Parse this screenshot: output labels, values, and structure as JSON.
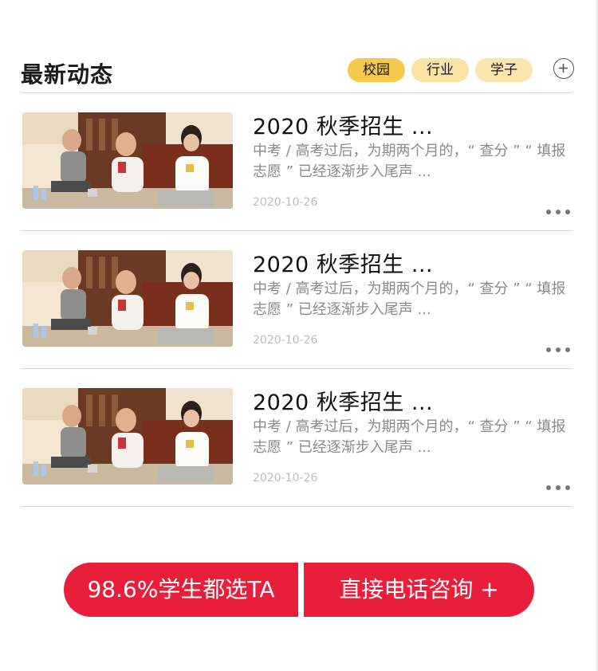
{
  "section": {
    "title": "最新动态",
    "tags": [
      {
        "label": "校园"
      },
      {
        "label": "行业"
      },
      {
        "label": "学子"
      }
    ]
  },
  "news": [
    {
      "title": "2020 秋季招生 ...",
      "desc": "中考 / 高考过后，为期两个月的，“ 查分 ” “ 填报志愿 ” 已经逐渐步入尾声 ...",
      "date": "2020-10-26"
    },
    {
      "title": "2020 秋季招生 ...",
      "desc": "中考 / 高考过后，为期两个月的，“ 查分 ” “ 填报志愿 ” 已经逐渐步入尾声 ...",
      "date": "2020-10-26"
    },
    {
      "title": "2020 秋季招生 ...",
      "desc": "中考 / 高考过后，为期两个月的，“ 查分 ” “ 填报志愿 ” 已经逐渐步入尾声 ...",
      "date": "2020-10-26"
    }
  ],
  "cta": {
    "left_label": "98.6%学生都选TA",
    "right_label": "直接电话咨询 +"
  },
  "colors": {
    "accent": "#e91e3b",
    "tag_active": "#f5c94a",
    "tag_inactive": "#fbe3a4"
  },
  "icons": {
    "add": "plus-circle-icon",
    "more": "more-dots-icon"
  }
}
